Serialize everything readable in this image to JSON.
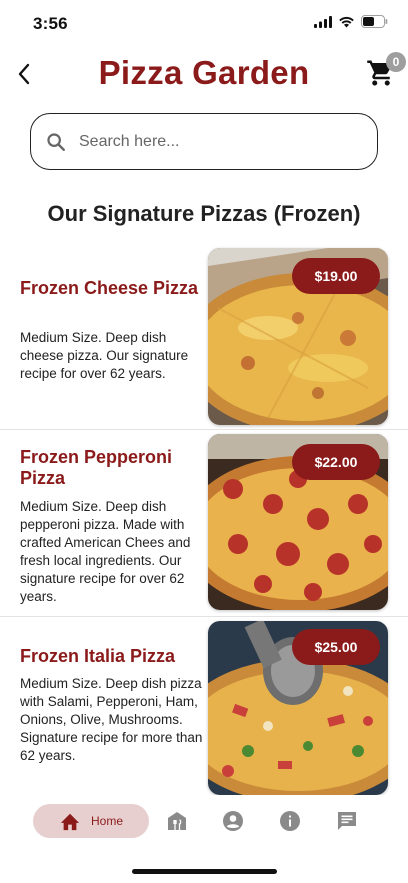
{
  "status": {
    "time": "3:56"
  },
  "header": {
    "title": "Pizza Garden",
    "cart_count": "0"
  },
  "search": {
    "placeholder": "Search here...",
    "value": ""
  },
  "section": {
    "title": "Our Signature Pizzas (Frozen)"
  },
  "products": [
    {
      "name": "Frozen Cheese Pizza",
      "description": "Medium Size. Deep dish cheese pizza. Our signature recipe for over 62 years.",
      "price": "$19.00"
    },
    {
      "name": "Frozen Pepperoni Pizza",
      "description": "Medium Size. Deep dish pepperoni pizza. Made with crafted American Chees and fresh local ingredients. Our signature recipe for over 62 years.",
      "price": "$22.00"
    },
    {
      "name": "Frozen Italia Pizza",
      "description": "Medium Size. Deep dish pizza with Salami, Pepperoni, Ham, Onions, Olive, Mushrooms. Signature recipe for more than 62 years.",
      "price": "$25.00"
    }
  ],
  "nav": {
    "home_label": "Home",
    "icons": [
      "home-icon",
      "restaurant-icon",
      "account-icon",
      "info-icon",
      "chat-icon"
    ]
  },
  "colors": {
    "brand": "#8b1a1a",
    "nav_active_bg": "#e8cfcf",
    "badge_grey": "#9e9e9e"
  }
}
